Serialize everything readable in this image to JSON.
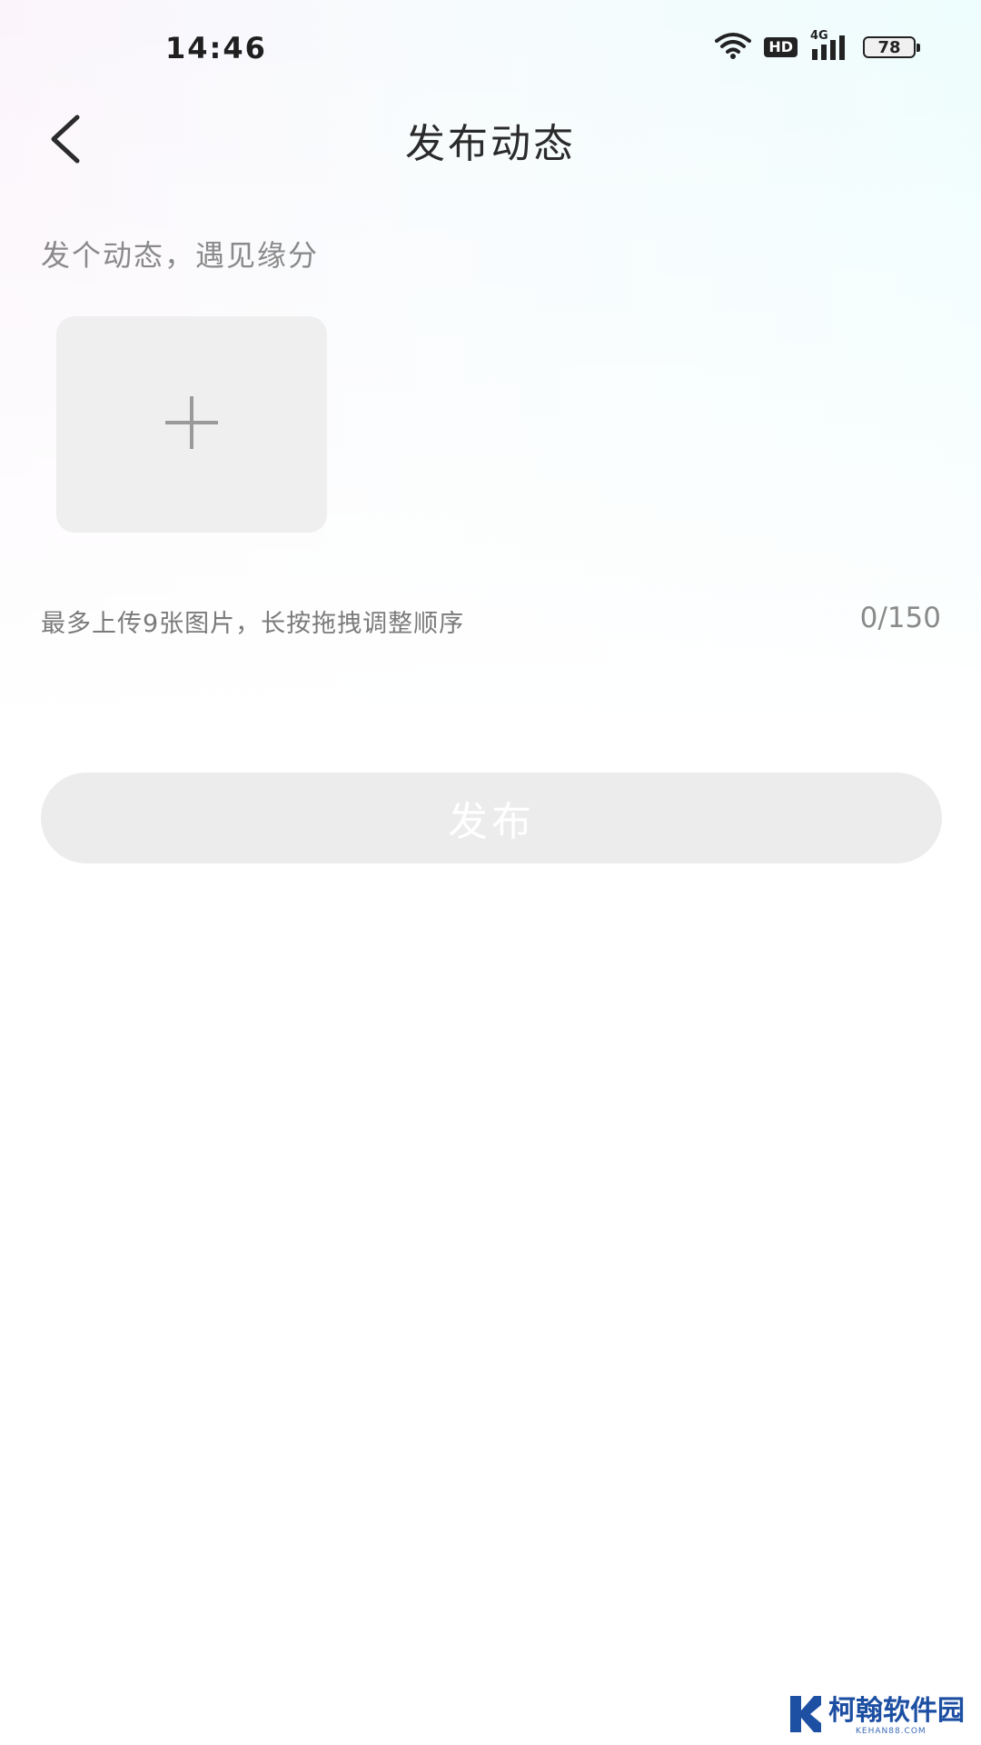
{
  "status_bar": {
    "time": "14:46",
    "network": "4G",
    "hd_label": "HD",
    "battery_level": "78"
  },
  "header": {
    "back_icon": "chevron-left-icon",
    "title": "发布动态"
  },
  "content": {
    "prompt_placeholder": "发个动态，遇见缘分",
    "add_photo_icon": "plus-icon",
    "upload_hint": "最多上传9张图片，长按拖拽调整顺序",
    "char_count": "0/150"
  },
  "actions": {
    "publish_label": "发布"
  },
  "watermark": {
    "name": "柯翰软件园",
    "url": "KEHAN88.COM"
  },
  "colors": {
    "title_text": "#2b2b2b",
    "hint_text": "#8a8a8a",
    "tile_background": "#efefef",
    "button_disabled": "#ececec",
    "watermark_blue": "#1d4fa3"
  }
}
